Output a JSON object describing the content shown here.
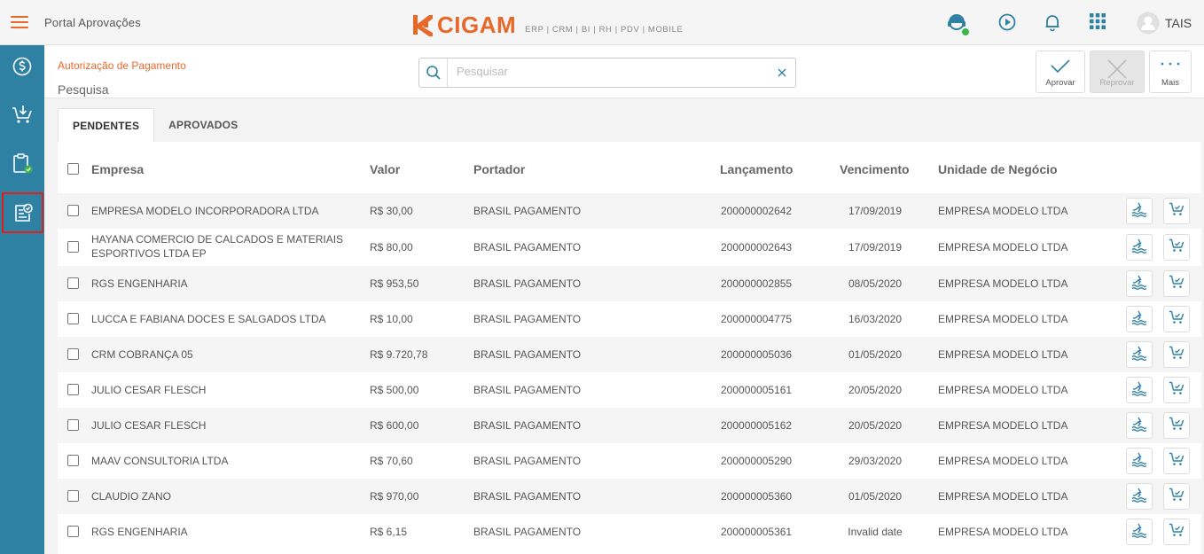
{
  "app": {
    "title": "Portal Aprovações",
    "logo_text": "CIGAM",
    "logo_subtitle": "ERP | CRM | BI | RH | PDV | MOBILE",
    "user_name": "TAIS"
  },
  "colors": {
    "accent": "#e8682a",
    "sidebar": "#2f81a4",
    "icon_blue": "#2f81a4",
    "status_online": "#3cb54a"
  },
  "header": {
    "breadcrumb": "Autorização de Pagamento",
    "title": "Pesquisa",
    "search_placeholder": "Pesquisar",
    "actions": [
      {
        "label": "Aprovar",
        "icon": "check-icon",
        "enabled": true
      },
      {
        "label": "Reprovar",
        "icon": "x-icon",
        "enabled": false
      },
      {
        "label": "Mais",
        "icon": "more-dots-icon",
        "enabled": true
      }
    ]
  },
  "sidebar": {
    "items": [
      {
        "name": "dollar-circle-icon"
      },
      {
        "name": "cart-download-icon"
      },
      {
        "name": "clipboard-check-icon"
      },
      {
        "name": "document-approve-icon",
        "active": true
      }
    ]
  },
  "tabs": [
    {
      "label": "PENDENTES",
      "active": true
    },
    {
      "label": "APROVADOS",
      "active": false
    }
  ],
  "table": {
    "columns": [
      "Empresa",
      "Valor",
      "Portador",
      "Lançamento",
      "Vencimento",
      "Unidade de Negócio"
    ],
    "rows": [
      {
        "empresa": "EMPRESA MODELO INCORPORADORA LTDA",
        "valor": "R$ 30,00",
        "portador": "BRASIL PAGAMENTO",
        "lancamento": "200000002642",
        "vencimento": "17/09/2019",
        "unidade": "EMPRESA MODELO LTDA"
      },
      {
        "empresa": "HAYANA COMERCIO DE CALCADOS E MATERIAIS ESPORTIVOS LTDA EP",
        "valor": "R$ 80,00",
        "portador": "BRASIL PAGAMENTO",
        "lancamento": "200000002643",
        "vencimento": "17/09/2019",
        "unidade": "EMPRESA MODELO LTDA"
      },
      {
        "empresa": "RGS ENGENHARIA",
        "valor": "R$ 953,50",
        "portador": "BRASIL PAGAMENTO",
        "lancamento": "200000002855",
        "vencimento": "08/05/2020",
        "unidade": "EMPRESA MODELO LTDA"
      },
      {
        "empresa": "LUCCA E FABIANA DOCES E SALGADOS LTDA",
        "valor": "R$ 10,00",
        "portador": "BRASIL PAGAMENTO",
        "lancamento": "200000004775",
        "vencimento": "16/03/2020",
        "unidade": "EMPRESA MODELO LTDA"
      },
      {
        "empresa": "CRM COBRANÇA 05",
        "valor": "R$ 9.720,78",
        "portador": "BRASIL PAGAMENTO",
        "lancamento": "200000005036",
        "vencimento": "01/05/2020",
        "unidade": "EMPRESA MODELO LTDA"
      },
      {
        "empresa": "JULIO CESAR FLESCH",
        "valor": "R$ 500,00",
        "portador": "BRASIL PAGAMENTO",
        "lancamento": "200000005161",
        "vencimento": "20/05/2020",
        "unidade": "EMPRESA MODELO LTDA"
      },
      {
        "empresa": "JULIO CESAR FLESCH",
        "valor": "R$ 600,00",
        "portador": "BRASIL PAGAMENTO",
        "lancamento": "200000005162",
        "vencimento": "20/05/2020",
        "unidade": "EMPRESA MODELO LTDA"
      },
      {
        "empresa": "MAAV CONSULTORIA LTDA",
        "valor": "R$ 70,60",
        "portador": "BRASIL PAGAMENTO",
        "lancamento": "200000005290",
        "vencimento": "29/03/2020",
        "unidade": "EMPRESA MODELO LTDA"
      },
      {
        "empresa": "CLAUDIO ZANO",
        "valor": "R$ 970,00",
        "portador": "BRASIL PAGAMENTO",
        "lancamento": "200000005360",
        "vencimento": "01/05/2020",
        "unidade": "EMPRESA MODELO LTDA"
      },
      {
        "empresa": "RGS ENGENHARIA",
        "valor": "R$ 6,15",
        "portador": "BRASIL PAGAMENTO",
        "lancamento": "200000005361",
        "vencimento": "Invalid date",
        "unidade": "EMPRESA MODELO LTDA"
      }
    ]
  }
}
